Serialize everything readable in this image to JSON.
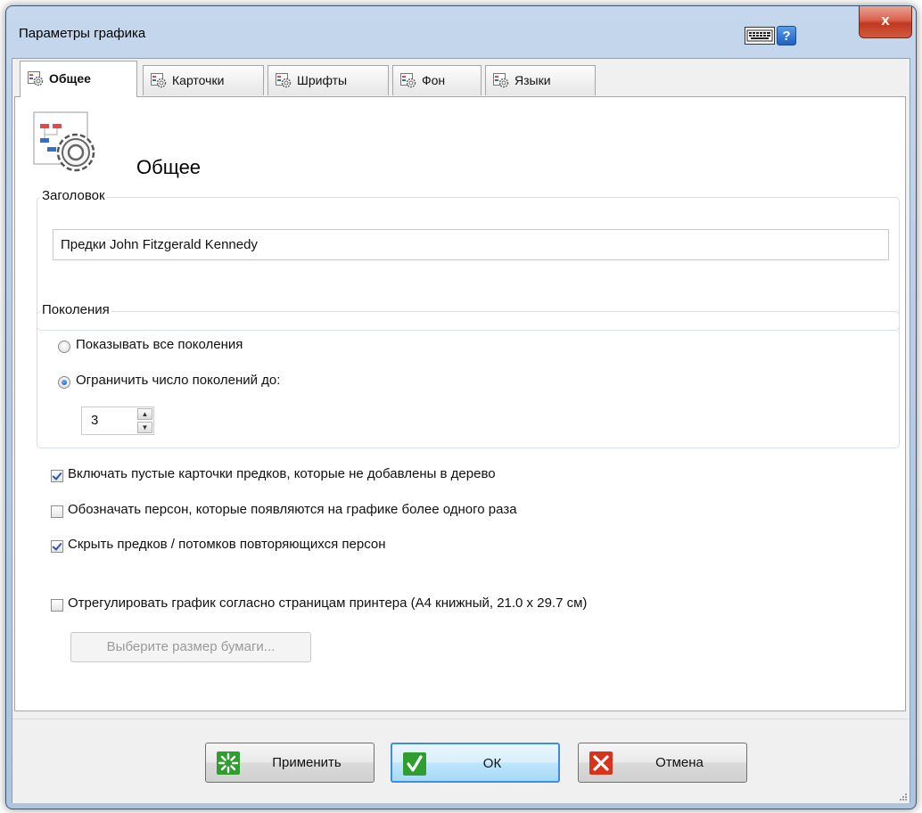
{
  "window": {
    "title": "Параметры графика",
    "close_label": "x",
    "help_label": "?"
  },
  "tabs": [
    {
      "label": "Общее",
      "active": true
    },
    {
      "label": "Карточки",
      "active": false
    },
    {
      "label": "Шрифты",
      "active": false
    },
    {
      "label": "Фон",
      "active": false
    },
    {
      "label": "Языки",
      "active": false
    }
  ],
  "general": {
    "heading": "Общее",
    "title_group": {
      "label": "Заголовок",
      "value": "Предки John Fitzgerald Kennedy"
    },
    "generations": {
      "label": "Поколения",
      "radio_all": {
        "label": "Показывать все поколения",
        "selected": false
      },
      "radio_limit": {
        "label": "Ограничить число поколений до:",
        "selected": true
      },
      "limit_value": "3"
    },
    "options": {
      "include_empty": {
        "label": "Включать пустые карточки предков, которые не добавлены в дерево",
        "checked": true
      },
      "mark_duplicates": {
        "label": "Обозначать персон, которые появляются на графике более одного раза",
        "checked": false
      },
      "hide_repeated": {
        "label": "Скрыть предков / потомков повторяющихся персон",
        "checked": true
      },
      "fit_printer": {
        "label": "Отрегулировать график согласно страницам принтера (А4 книжный, 21.0 x 29.7 см)",
        "checked": false
      }
    },
    "paper_size_button": "Выберите размер бумаги..."
  },
  "footer": {
    "apply": "Применить",
    "ok": "ОК",
    "cancel": "Отмена"
  },
  "colors": {
    "accent": "#3d8ee0",
    "close": "#c0381f",
    "apply_icon": "#2e9e2e",
    "ok_icon": "#2e9e2e",
    "cancel_icon": "#d8341c"
  }
}
